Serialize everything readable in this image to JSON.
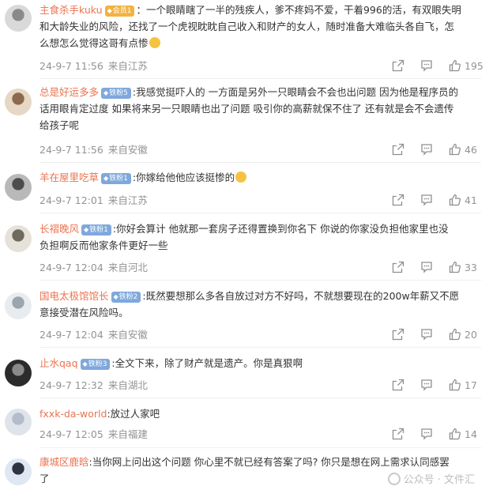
{
  "comments": [
    {
      "username": "主食杀手kuku",
      "badge": "会员1",
      "badge_color": "#f3b23f",
      "text_lines": [
        "：一个眼睛瞎了一半的残疾人，爹不疼妈不爱，干着996的活，有双眼失明",
        "和大龄失业的风险，还找了一个虎视眈眈自己收入和财产的女人，随时准备大难临头各自飞，怎",
        "么想怎么觉得这哥有点惨"
      ],
      "timestamp": "24-9-7 11:56",
      "location": "来自江苏",
      "likes": "195"
    },
    {
      "username": "总是好运多多",
      "badge": "铁粉5",
      "badge_color": "#7fa8dc",
      "text_lines": [
        ":我感觉挺吓人的 一方面是另外一只眼睛会不会也出问题 因为他是程序员的",
        "话用眼肯定过度 如果将来另一只眼睛也出了问题 吸引你的高薪就保不住了 还有就是会不会遗传",
        "给孩子呢"
      ],
      "timestamp": "24-9-7 11:56",
      "location": "来自安徽",
      "likes": "46"
    },
    {
      "username": "羊在屋里吃草",
      "badge": "铁粉1",
      "badge_color": "#7fa8dc",
      "text_lines": [
        ":你嫁给他他应该挺惨的"
      ],
      "timestamp": "24-9-7 12:01",
      "location": "来自江苏",
      "likes": "41"
    },
    {
      "username": "长褶晚风",
      "badge": "铁粉1",
      "badge_color": "#7fa8dc",
      "text_lines": [
        ":你好会算计 他就那一套房子还得置换到你名下 你说的你家没负担他家里也没",
        "负担啊反而他家条件更好一些"
      ],
      "timestamp": "24-9-7 12:04",
      "location": "来自河北",
      "likes": "33"
    },
    {
      "username": "国电太极馆馆长",
      "badge": "铁粉2",
      "badge_color": "#7fa8dc",
      "text_lines": [
        ":既然要想那么多各自放过对方不好吗，不就想要现在的200w年薪又不愿",
        "意接受潜在风险吗。"
      ],
      "timestamp": "24-9-7 12:04",
      "location": "来自安徽",
      "likes": "20"
    },
    {
      "username": "止水qaq",
      "badge": "铁粉3",
      "badge_color": "#7fa8dc",
      "text_lines": [
        ":全文下来，除了财产就是遗产。你是真狠啊"
      ],
      "timestamp": "24-9-7 12:32",
      "location": "来自湖北",
      "likes": "17"
    },
    {
      "username": "fxxk-da-world",
      "badge": "",
      "badge_color": "",
      "text_lines": [
        ":放过人家吧"
      ],
      "timestamp": "24-9-7 12:05",
      "location": "来自福建",
      "likes": "14"
    },
    {
      "username": "康城区鹿晗",
      "badge": "",
      "badge_color": "",
      "text_lines": [
        ":当你网上问出这个问题 你心里不就已经有答案了吗? 你只是想在网上需求认同感罢",
        "了"
      ],
      "timestamp": "",
      "location": "",
      "likes": ""
    }
  ],
  "watermark": {
    "text": "公众号 · 文件汇"
  },
  "theme": {
    "username_color": "#eb7350",
    "meta_color": "#939393",
    "text_color": "#333333"
  }
}
